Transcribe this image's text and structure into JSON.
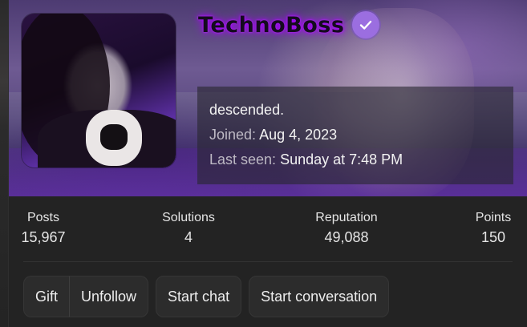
{
  "profile": {
    "username": "TechnoBoss",
    "verified_icon": "check-badge-icon",
    "status_text": "descended.",
    "joined_label": "Joined:",
    "joined_value": "Aug 4, 2023",
    "last_seen_label": "Last seen:",
    "last_seen_value": "Sunday at 7:48 PM"
  },
  "stats": [
    {
      "label": "Posts",
      "value": "15,967"
    },
    {
      "label": "Solutions",
      "value": "4"
    },
    {
      "label": "Reputation",
      "value": "49,088"
    },
    {
      "label": "Points",
      "value": "150"
    }
  ],
  "actions": {
    "gift": "Gift",
    "unfollow": "Unfollow",
    "start_chat": "Start chat",
    "start_conversation": "Start conversation"
  },
  "colors": {
    "accent": "#9b6ee0",
    "username_glow": "#b100ff",
    "card_bg": "#232323"
  }
}
